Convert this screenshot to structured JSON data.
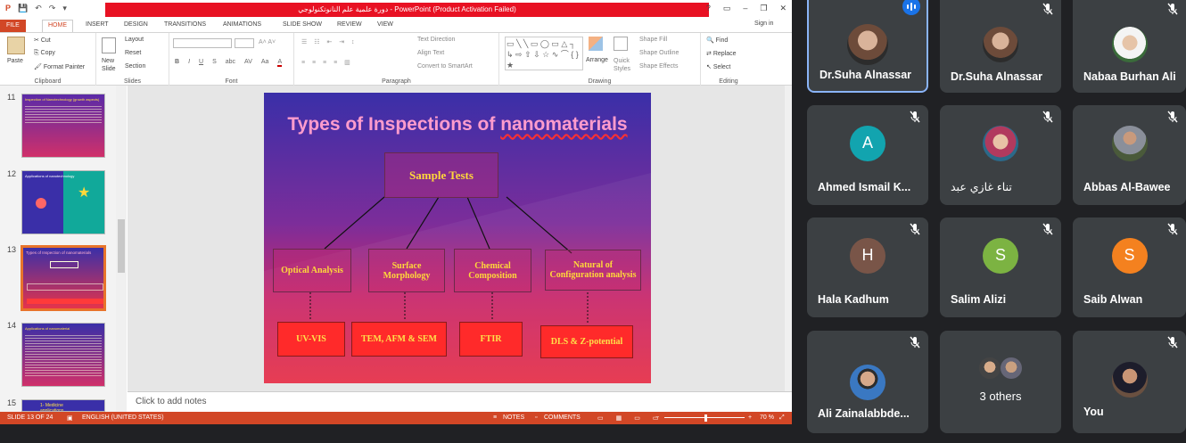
{
  "ppt": {
    "quick_access": [
      "P",
      "💾",
      "↶",
      "↷",
      "▾"
    ],
    "window_title": "دورة علمية علم النانوتكنولوجي - PowerPoint (Product Activation Failed)",
    "window_buttons": [
      "?",
      "▭",
      "–",
      "❐",
      "✕"
    ],
    "sign_in": "Sign in",
    "tabs": [
      "FILE",
      "HOME",
      "INSERT",
      "DESIGN",
      "TRANSITIONS",
      "ANIMATIONS",
      "SLIDE SHOW",
      "REVIEW",
      "VIEW"
    ],
    "ribbon": {
      "clipboard": {
        "paste": "Paste",
        "cut": "Cut",
        "copy": "Copy",
        "format_painter": "Format Painter",
        "label": "Clipboard"
      },
      "slides": {
        "new_slide": "New Slide",
        "layout": "Layout",
        "reset": "Reset",
        "section": "Section",
        "label": "Slides"
      },
      "font": {
        "label": "Font",
        "buttons": [
          "B",
          "I",
          "U",
          "S",
          "abc",
          "AV",
          "Aa",
          "A"
        ]
      },
      "paragraph": {
        "label": "Paragraph",
        "text_direction": "Text Direction",
        "align_text": "Align Text",
        "convert_smartart": "Convert to SmartArt"
      },
      "drawing": {
        "label": "Drawing",
        "arrange": "Arrange",
        "quick_styles": "Quick Styles",
        "shape_fill": "Shape Fill",
        "shape_outline": "Shape Outline",
        "shape_effects": "Shape Effects"
      },
      "editing": {
        "label": "Editing",
        "find": "Find",
        "replace": "Replace",
        "select": "Select"
      }
    },
    "thumbnails": [
      {
        "num": "11",
        "title": "Inspection of Nanotechnology (growth aspects)",
        "selected": false
      },
      {
        "num": "12",
        "title": "Applications of nanotechnology",
        "selected": false
      },
      {
        "num": "13",
        "title": "Types of Inspection of nanomaterials",
        "selected": true
      },
      {
        "num": "14",
        "title": "Applications of nanomaterial",
        "selected": false
      },
      {
        "num": "15",
        "title": "1- Medicine applications",
        "selected": false
      }
    ],
    "slide": {
      "title_prefix": "Types of Inspections of ",
      "title_keyword": "nanomaterials",
      "root": "Sample Tests",
      "categories": [
        "Optical Analysis",
        "Surface Morphology",
        "Chemical Composition",
        "Natural of Configuration analysis"
      ],
      "methods": [
        "UV-VIS",
        "TEM, AFM & SEM",
        "FTIR",
        "DLS & Z-potential"
      ]
    },
    "notes_placeholder": "Click to add notes",
    "status": {
      "slide_count": "SLIDE 13 OF 24",
      "language": "ENGLISH (UNITED STATES)",
      "notes": "NOTES",
      "comments": "COMMENTS",
      "zoom": "70 %"
    }
  },
  "meet": {
    "participants": [
      {
        "name": "Dr.Suha Alnassar",
        "type": "photo",
        "photo": "woman-hijab",
        "speaking": true,
        "muted": false
      },
      {
        "name": "Dr.Suha Alnassar",
        "type": "photo",
        "photo": "woman-hijab",
        "speaking": false,
        "muted": true
      },
      {
        "name": "Nabaa Burhan Ali",
        "type": "photo",
        "photo": "woman-white-hijab",
        "speaking": false,
        "muted": true
      },
      {
        "name": "Ahmed Ismail K...",
        "type": "letter",
        "letter": "A",
        "color": "#12a4af",
        "muted": true
      },
      {
        "name": "تناء غازي عبد",
        "type": "photo",
        "photo": "woman-portrait",
        "muted": true
      },
      {
        "name": "Abbas Al-Bawee",
        "type": "photo",
        "photo": "man-suit",
        "muted": true
      },
      {
        "name": "Hala Kadhum",
        "type": "letter",
        "letter": "H",
        "color": "#795548",
        "muted": true
      },
      {
        "name": "Salim Alizi",
        "type": "letter",
        "letter": "S",
        "color": "#7cb342",
        "muted": true
      },
      {
        "name": "Saib Alwan",
        "type": "letter",
        "letter": "S",
        "color": "#f4811f",
        "muted": true
      },
      {
        "name": "Ali Zainalabbde...",
        "type": "photo",
        "photo": "man-glasses",
        "muted": true
      },
      {
        "name": "3 others",
        "type": "group",
        "muted": false
      },
      {
        "name": "You",
        "type": "photo",
        "photo": "man-suit-dark",
        "muted": true
      }
    ]
  }
}
